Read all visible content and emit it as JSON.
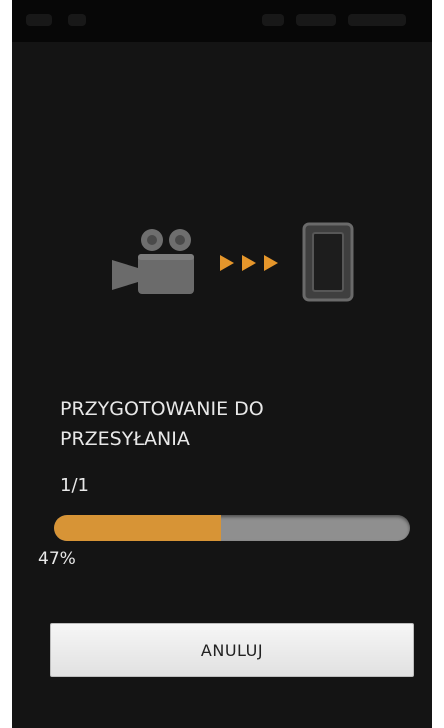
{
  "transfer": {
    "status_line1": "PRZYGOTOWANIE DO",
    "status_line2": "PRZESYŁANIA",
    "file_count": "1/1",
    "progress_fraction": 0.47,
    "progress_label": "47%"
  },
  "actions": {
    "cancel_label": "ANULUJ"
  },
  "icons": {
    "source": "camcorder-icon",
    "direction": "arrows-right-icon",
    "target": "smartphone-icon"
  },
  "colors": {
    "background": "#141414",
    "progress_fill": "#d79436",
    "progress_track": "#8f8f8f",
    "arrow_accent": "#e5962b"
  }
}
